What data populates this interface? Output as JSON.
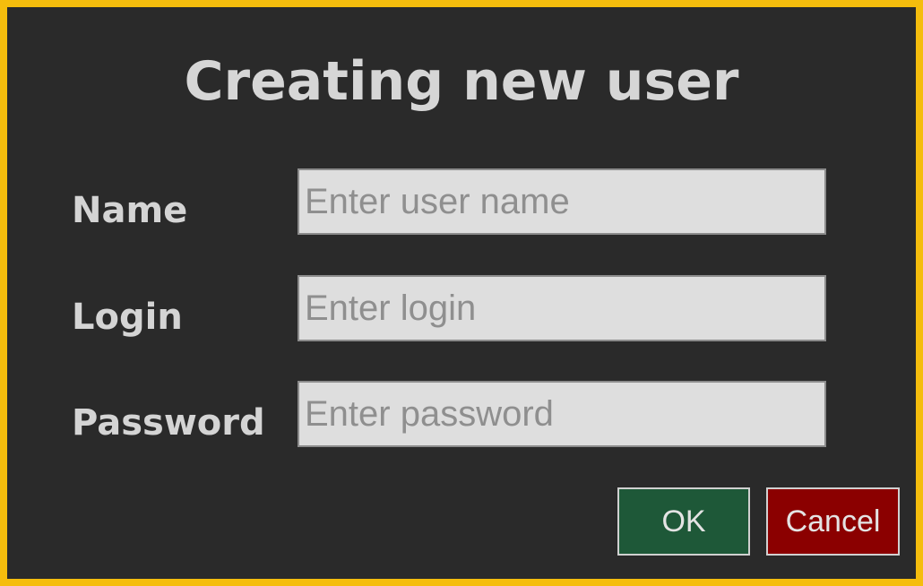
{
  "dialog": {
    "title": "Creating new user",
    "accent_color": "#f5bd0d",
    "background_color": "#2a2a2a"
  },
  "form": {
    "name": {
      "label": "Name",
      "value": "",
      "placeholder": "Enter user name"
    },
    "login": {
      "label": "Login",
      "value": "",
      "placeholder": "Enter login"
    },
    "password": {
      "label": "Password",
      "value": "",
      "placeholder": "Enter password"
    }
  },
  "buttons": {
    "ok_label": "OK",
    "ok_color": "#1e5838",
    "cancel_label": "Cancel",
    "cancel_color": "#8b0000"
  }
}
